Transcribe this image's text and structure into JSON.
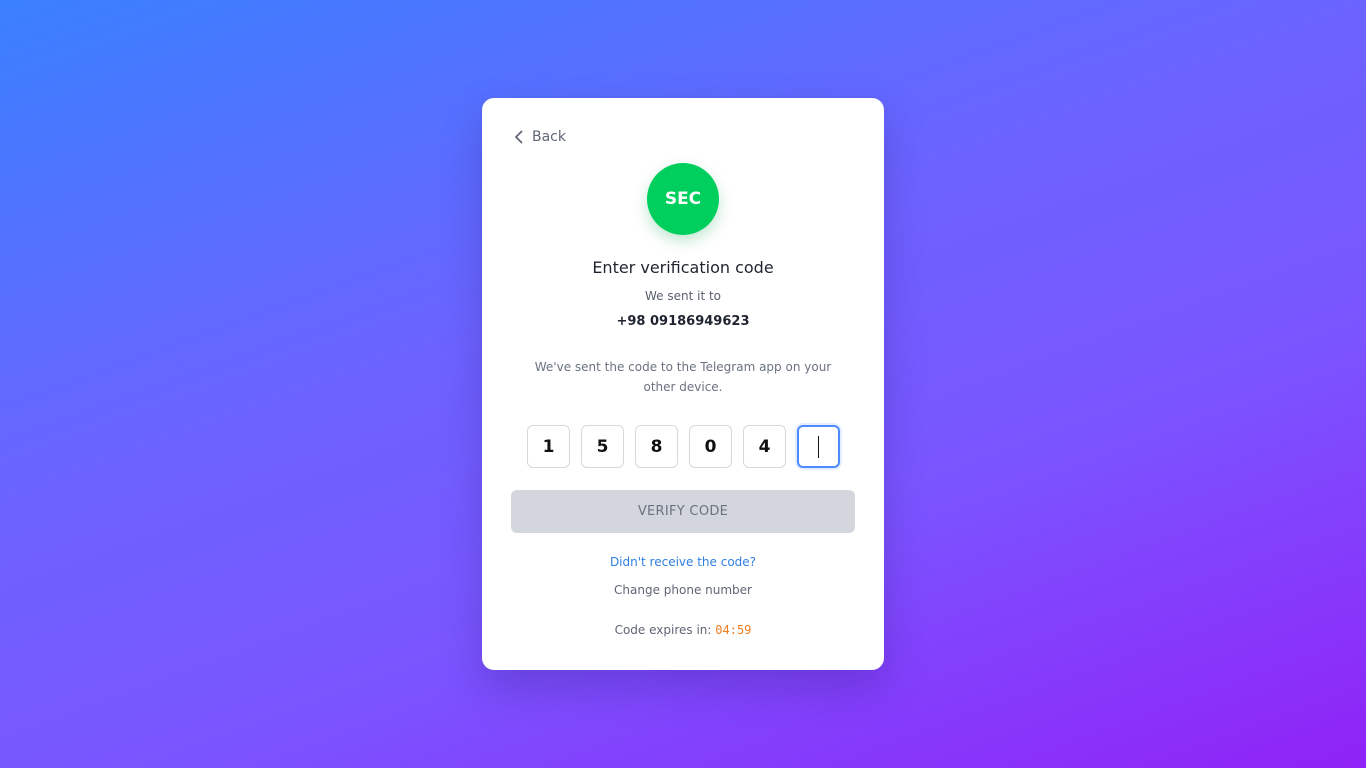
{
  "back": {
    "label": "Back",
    "icon": "chevron-left-icon"
  },
  "logo": {
    "text": "SEC",
    "color": "#00cf5e"
  },
  "title": "Enter verification code",
  "sent_label": "We sent it to",
  "phone": "+98 09186949623",
  "hint": "We've sent the code to the Telegram app on your other device.",
  "code": {
    "digits": [
      "1",
      "5",
      "8",
      "0",
      "4",
      ""
    ],
    "active_index": 5
  },
  "verify_button": {
    "label": "VERIFY CODE",
    "enabled": false
  },
  "resend_link": "Didn't receive the code?",
  "change_link": "Change phone number",
  "expires": {
    "label": "Code expires in:",
    "time": "04:59",
    "color": "#f07d1e"
  },
  "colors": {
    "accent": "#2f7fe0",
    "focus": "#4f8bff"
  }
}
